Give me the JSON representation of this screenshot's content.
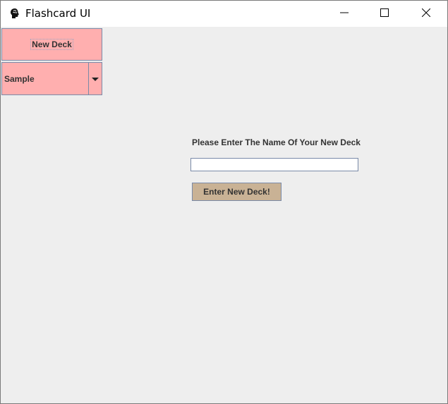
{
  "window": {
    "title": "Flashcard UI",
    "icons": {
      "app": "brain-icon",
      "minimize": "minimize-icon",
      "maximize": "maximize-icon",
      "close": "close-icon"
    }
  },
  "sidebar": {
    "new_deck_label": "New Deck",
    "deck_select": {
      "selected": "Sample",
      "arrow_icon": "chevron-down-icon"
    }
  },
  "form": {
    "prompt": "Please Enter The Name Of Your New Deck",
    "deck_name_value": "",
    "submit_label": "Enter New Deck!"
  },
  "colors": {
    "sidebar_button": "#ffafaf",
    "submit_button": "#c9b295",
    "background": "#eeeeee",
    "border": "#7a8aa8"
  }
}
